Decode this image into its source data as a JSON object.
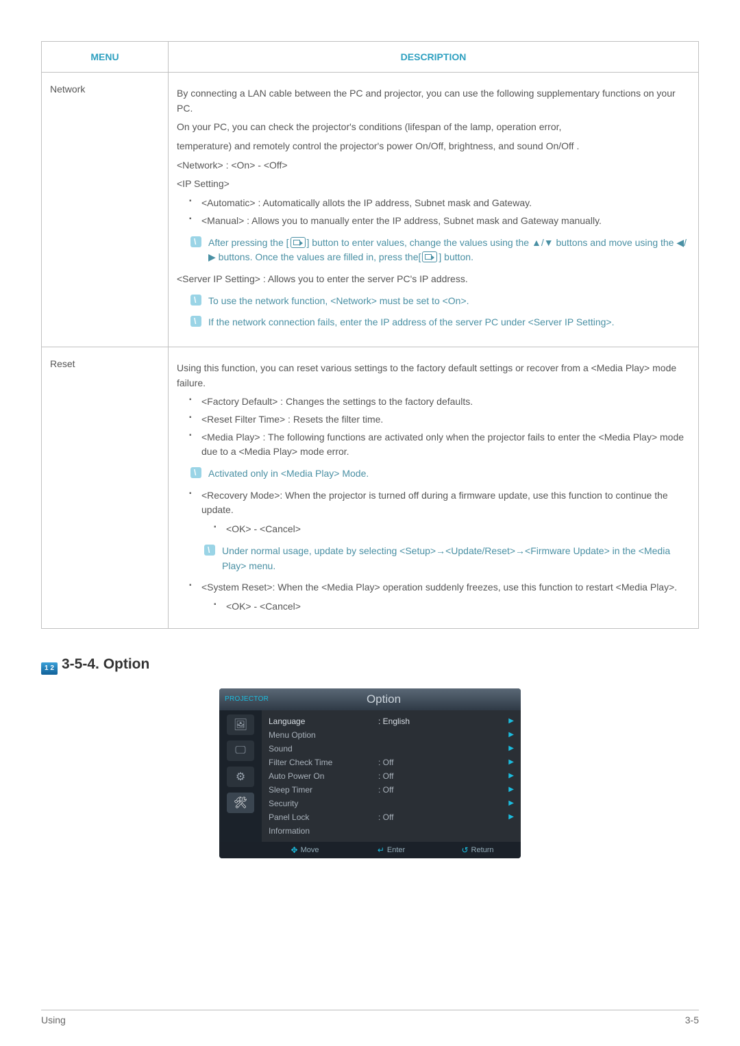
{
  "table_headers": {
    "menu": "MENU",
    "desc": "DESCRIPTION"
  },
  "rows": [
    {
      "menu": "Network",
      "p1": "By connecting a LAN cable between the PC and projector, you can use the following supplementary functions on your PC.",
      "p2": "On your PC, you can check the projector's conditions (lifespan of the lamp, operation error,",
      "p3": "temperature) and remotely control the projector's power On/Off, brightness, and sound On/Off .",
      "p4": "<Network> : <On> - <Off>",
      "p5": "<IP Setting>",
      "li1": "<Automatic> : Automatically allots the IP address, Subnet mask and Gateway.",
      "li2": "<Manual> : Allows you to manually enter the IP address, Subnet mask and Gateway manually.",
      "note1a": "After pressing the [",
      "note1b": "] button to enter values, change the values using the ▲/▼ buttons and move using the ◀/▶ buttons. Once the values are filled in, press the[",
      "note1c": "] button.",
      "p6": "<Server IP Setting> : Allows you to enter the server PC's IP address.",
      "note2": "To use the network function, <Network> must be set to <On>.",
      "note3": "If the network connection fails, enter the IP address of the server PC under <Server IP Setting>."
    },
    {
      "menu": "Reset",
      "p1": "Using this function, you can reset various settings to the factory default settings or recover from a <Media Play> mode failure.",
      "li1": "<Factory Default> : Changes the settings to the factory defaults.",
      "li2": "<Reset Filter Time> : Resets the filter time.",
      "li3": "<Media Play> : The following functions are activated only when the projector fails to enter the <Media Play> mode due to a <Media Play> mode error.",
      "note1": "Activated only in <Media Play> Mode.",
      "sub1": "<Recovery Mode>: When the projector is turned off during a firmware update, use this function to continue the update.",
      "sub1a": "<OK> - <Cancel>",
      "note2": "Under normal usage, update by selecting <Setup>→<Update/Reset>→<Firmware Update> in the <Media Play> menu.",
      "sub2": "<System Reset>: When the <Media Play> operation suddenly freezes, use this function to restart <Media Play>.",
      "sub2a": "<OK> - <Cancel>"
    }
  ],
  "section": {
    "num_title": "3-5-4. Option"
  },
  "osd": {
    "projector": "PROJECTOR",
    "title": "Option",
    "items": [
      {
        "label": "Language",
        "value": ": English",
        "arrow": true,
        "sel": true
      },
      {
        "label": "Menu Option",
        "value": "",
        "arrow": true
      },
      {
        "label": "Sound",
        "value": "",
        "arrow": true
      },
      {
        "label": "Filter Check Time",
        "value": ": Off",
        "arrow": true
      },
      {
        "label": "Auto Power On",
        "value": ": Off",
        "arrow": true
      },
      {
        "label": "Sleep Timer",
        "value": ": Off",
        "arrow": true
      },
      {
        "label": "Security",
        "value": "",
        "arrow": true
      },
      {
        "label": "Panel Lock",
        "value": ": Off",
        "arrow": true
      },
      {
        "label": "Information",
        "value": "",
        "arrow": false
      }
    ],
    "footer": {
      "move": "Move",
      "enter": "Enter",
      "return": "Return"
    }
  },
  "page_footer": {
    "left": "Using",
    "right": "3-5"
  }
}
